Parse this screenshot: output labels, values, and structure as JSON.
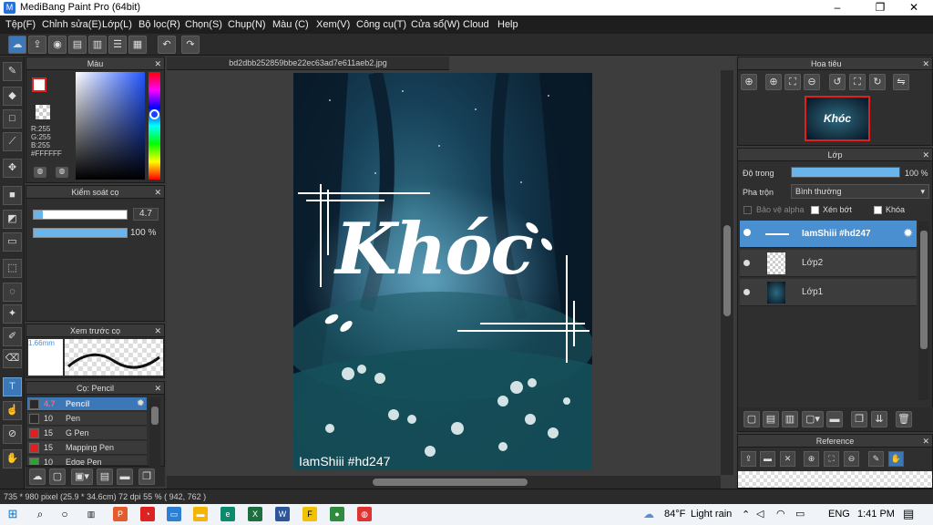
{
  "window": {
    "title": "MediBang Paint Pro (64bit)",
    "minimize": "–",
    "maximize": "❐",
    "close": "✕"
  },
  "menu": [
    "Tệp(F)",
    "Chỉnh sửa(E)",
    "Lớp(L)",
    "Bộ lọc(R)",
    "Chọn(S)",
    "Chụp(N)",
    "Màu (C)",
    "Xem(V)",
    "Công cụ(T)",
    "Cửa sổ(W)",
    "Cloud",
    "Help"
  ],
  "document": {
    "tab": "bd2dbb252859bbe22ec63ad7e611aeb2.jpg",
    "art_title": "Khóc",
    "watermark": "IamShiii #hd247"
  },
  "color_panel": {
    "title": "Màu",
    "r": "R:255",
    "g": "G:255",
    "b": "B:255",
    "hex": "#FFFFFF"
  },
  "brush_control": {
    "title": "Kiểm soát cọ",
    "size": "4.7",
    "opacity": "100 %",
    "size_fraction": 0.1,
    "opacity_fraction": 1.0
  },
  "brush_preview": {
    "title": "Xem trước cọ",
    "size": "1.66mm"
  },
  "brush_list": {
    "title": "Cọ: Pencil",
    "items": [
      {
        "size": "4.7",
        "name": "Pencil",
        "color": "#2a2a2a",
        "selected": true
      },
      {
        "size": "10",
        "name": "Pen",
        "color": "#2a2a2a",
        "selected": false
      },
      {
        "size": "15",
        "name": "G Pen",
        "color": "#e02020",
        "selected": false
      },
      {
        "size": "15",
        "name": "Mapping Pen",
        "color": "#e02020",
        "selected": false
      },
      {
        "size": "10",
        "name": "Edge Pen",
        "color": "#30a030",
        "selected": false
      }
    ]
  },
  "navigator": {
    "title": "Hoa tiêu",
    "thumb_text": "Khóc"
  },
  "layers": {
    "title": "Lớp",
    "opacity_label": "Độ trong",
    "opacity_value": "100 %",
    "opacity_fraction": 1.0,
    "blend_label": "Pha trộn",
    "blend_value": "Bình thường",
    "protect_alpha": "Bảo vệ alpha",
    "clipping": "Xén bớt",
    "lock": "Khóa",
    "items": [
      {
        "name": "IamShiii #hd247",
        "selected": true
      },
      {
        "name": "Lớp2",
        "selected": false
      },
      {
        "name": "Lớp1",
        "selected": false
      }
    ]
  },
  "reference": {
    "title": "Reference"
  },
  "status": {
    "text": "735 * 980 pixel  (25.9 * 34.6cm)  72 dpi  55 %  ( 942, 762 )"
  },
  "taskbar": {
    "weather_temp": "84°F",
    "weather_text": "Light rain",
    "lang": "ENG",
    "time": "1:41 PM"
  }
}
